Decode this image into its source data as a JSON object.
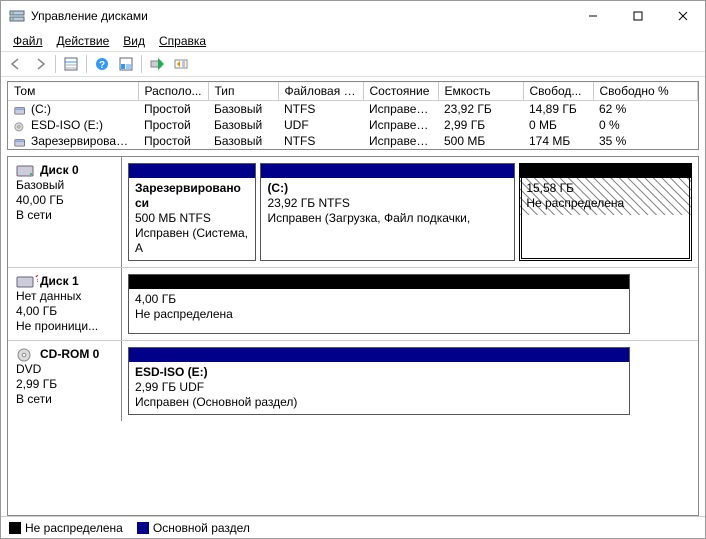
{
  "window": {
    "title": "Управление дисками"
  },
  "menu": {
    "file": "Файл",
    "action": "Действие",
    "view": "Вид",
    "help": "Справка"
  },
  "columns": [
    "Том",
    "Располо...",
    "Тип",
    "Файловая с...",
    "Состояние",
    "Емкость",
    "Свобод...",
    "Свободно %"
  ],
  "volumes": [
    {
      "icon": "drive-icon",
      "name": "(C:)",
      "layout": "Простой",
      "type": "Базовый",
      "fs": "NTFS",
      "status": "Исправен...",
      "capacity": "23,92 ГБ",
      "free": "14,89 ГБ",
      "freepct": "62 %"
    },
    {
      "icon": "cd-icon",
      "name": "ESD-ISO (E:)",
      "layout": "Простой",
      "type": "Базовый",
      "fs": "UDF",
      "status": "Исправен...",
      "capacity": "2,99 ГБ",
      "free": "0 МБ",
      "freepct": "0 %"
    },
    {
      "icon": "drive-icon",
      "name": "Зарезервировано...",
      "layout": "Простой",
      "type": "Базовый",
      "fs": "NTFS",
      "status": "Исправен...",
      "capacity": "500 МБ",
      "free": "174 МБ",
      "freepct": "35 %"
    }
  ],
  "disks": [
    {
      "icon": "hdd-icon",
      "name": "Диск 0",
      "type": "Базовый",
      "size": "40,00 ГБ",
      "status": "В сети",
      "parts": [
        {
          "kind": "primary",
          "flex": 20,
          "title": "Зарезервировано си",
          "l2": "500 МБ NTFS",
          "l3": "Исправен (Система, А"
        },
        {
          "kind": "primary",
          "flex": 40,
          "title": "(C:)",
          "l2": "23,92 ГБ NTFS",
          "l3": "Исправен (Загрузка, Файл подкачки, "
        },
        {
          "kind": "unalloc",
          "flex": 27,
          "hatched": true,
          "sel": true,
          "title": "",
          "l2": "15,58 ГБ",
          "l3": "Не распределена"
        }
      ]
    },
    {
      "icon": "hdd-unk-icon",
      "name": "Диск 1",
      "type": "Нет данных",
      "size": "4,00 ГБ",
      "status": "Не проиници...",
      "parts": [
        {
          "kind": "unalloc",
          "flex": 78,
          "title": "",
          "l2": "4,00 ГБ",
          "l3": "Не распределена"
        }
      ]
    },
    {
      "icon": "cdrom-icon",
      "name": "CD-ROM 0",
      "type": "DVD",
      "size": "2,99 ГБ",
      "status": "В сети",
      "parts": [
        {
          "kind": "primary",
          "flex": 78,
          "title": "ESD-ISO  (E:)",
          "l2": "2,99 ГБ UDF",
          "l3": "Исправен (Основной раздел)"
        }
      ]
    }
  ],
  "legend": {
    "unalloc": "Не распределена",
    "primary": "Основной раздел"
  }
}
